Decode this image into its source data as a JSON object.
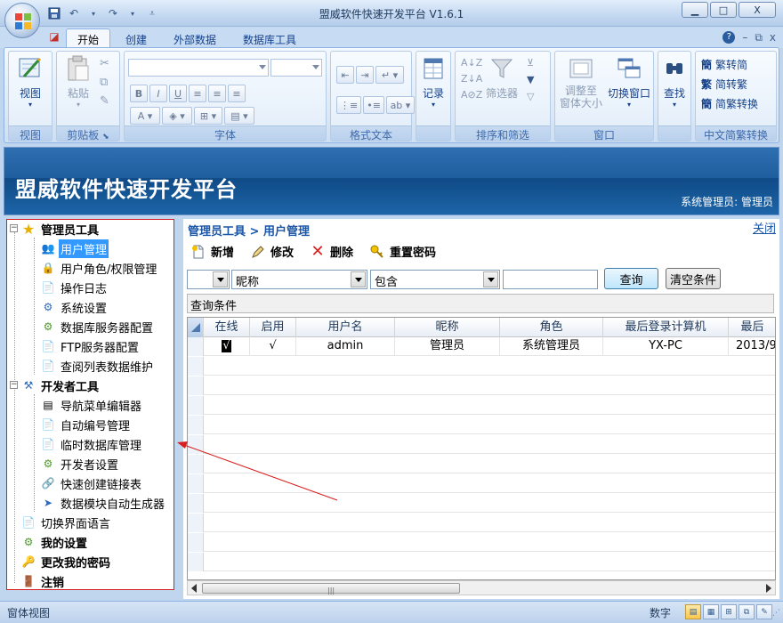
{
  "window": {
    "title": "盟威软件快速开发平台 V1.6.1",
    "min_label": "▁",
    "max_label": "□",
    "close_label": "X"
  },
  "qat": {
    "save_icon": "save-icon",
    "undo_icon": "undo-icon",
    "redo_icon": "redo-icon"
  },
  "ribbon": {
    "tabs": [
      {
        "label": "开始",
        "active": true
      },
      {
        "label": "创建"
      },
      {
        "label": "外部数据"
      },
      {
        "label": "数据库工具"
      }
    ],
    "help_label": "?",
    "groups": {
      "view": {
        "label": "视图",
        "button": "视图"
      },
      "clipboard": {
        "label": "剪贴板",
        "paste": "粘贴"
      },
      "font": {
        "label": "字体"
      },
      "rich_text": {
        "label": "格式文本"
      },
      "records": {
        "label": "记录",
        "button": "记录"
      },
      "sort_filter": {
        "label": "排序和筛选",
        "filter": "筛选器"
      },
      "window": {
        "label": "窗口",
        "fit_line1": "调整至",
        "fit_line2": "窗体大小",
        "switch": "切换窗口"
      },
      "find": {
        "label": "查找",
        "button": "查找"
      },
      "chinese": {
        "label": "中文简繁转换",
        "t2s": "繁转简",
        "s2t": "简转繁",
        "convert": "简繁转换"
      }
    }
  },
  "banner": {
    "title": "盟威软件快速开发平台",
    "user": "系统管理员: 管理员"
  },
  "tree": {
    "admin_tools": "管理员工具",
    "user_mgmt": "用户管理",
    "roles": "用户角色/权限管理",
    "oplog": "操作日志",
    "sys_settings": "系统设置",
    "db_server": "数据库服务器配置",
    "ftp_server": "FTP服务器配置",
    "list_maint": "查阅列表数据维护",
    "dev_tools": "开发者工具",
    "nav_editor": "导航菜单编辑器",
    "auto_number": "自动编号管理",
    "temp_db": "临时数据库管理",
    "dev_settings": "开发者设置",
    "quick_link": "快速创建链接表",
    "module_gen": "数据模块自动生成器",
    "switch_lang": "切换界面语言",
    "my_settings": "我的设置",
    "change_pwd": "更改我的密码",
    "logout": "注销"
  },
  "main": {
    "breadcrumb": "管理员工具 > 用户管理",
    "close": "关闭",
    "toolbar": {
      "add": "新增",
      "edit": "修改",
      "delete": "删除",
      "reset_pwd": "重置密码"
    },
    "query": {
      "field_value": "昵称",
      "operator_value": "包含",
      "search_value": "",
      "query_button": "查询",
      "clear_button": "清空条件"
    },
    "conditions_label": "查询条件"
  },
  "grid": {
    "columns": [
      "在线",
      "启用",
      "用户名",
      "昵称",
      "角色",
      "最后登录计算机",
      "最后"
    ],
    "rows": [
      [
        "√",
        "√",
        "admin",
        "管理员",
        "系统管理员",
        "YX-PC",
        "2013/9"
      ]
    ],
    "grip": "|||"
  },
  "status": {
    "left": "窗体视图",
    "mode": "数字"
  },
  "colors": {
    "accent": "#1b56a6",
    "annotation": "#d81e1e",
    "selection": "#3399ff"
  }
}
